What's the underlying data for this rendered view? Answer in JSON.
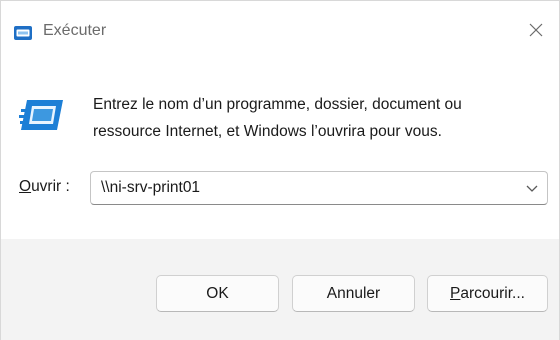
{
  "window": {
    "title": "Exécuter",
    "close_glyph": "✕",
    "icon": "run-icon"
  },
  "body": {
    "icon": "run-large-icon",
    "description_line1": "Entrez le nom d’un programme, dossier, document ou",
    "description_line2": "ressource Internet, et Windows l’ouvrira pour vous.",
    "open_label_accel": "O",
    "open_label_rest": "uvrir :",
    "input_value": "\\\\ni-srv-print01"
  },
  "buttons": {
    "ok_label": "OK",
    "cancel_label": "Annuler",
    "browse_accel": "P",
    "browse_rest": "arcourir..."
  },
  "colors": {
    "accent": "#1a73c9",
    "footer_bg": "#f3f3f3"
  }
}
